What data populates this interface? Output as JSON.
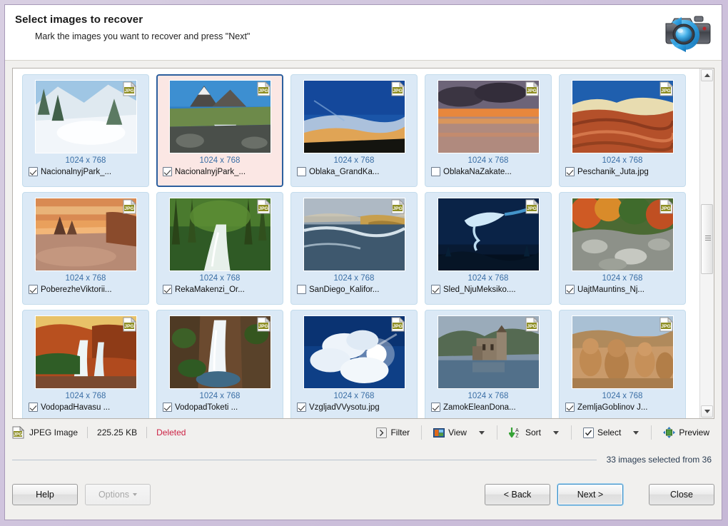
{
  "window": {
    "title": "Select images to recover",
    "subtitle": "Mark the images you want to recover and press \"Next\"",
    "header_icon": "camera-recovery-icon",
    "accent_selected": "#2c5f9e",
    "tile_bg": "#dbe9f6",
    "tile_selected_bg": "#fbe7e4",
    "dims_color": "#3a6ea5",
    "deleted_color": "#cc2244"
  },
  "grid": {
    "items": [
      {
        "name": "NacionalnyjPark_...",
        "dims": "1024 x 768",
        "type": "JPG",
        "checked": true,
        "selected": false,
        "scene": "snow-forest"
      },
      {
        "name": "NacionalnyjPark_...",
        "dims": "1024 x 768",
        "type": "JPG",
        "checked": true,
        "selected": true,
        "scene": "mountain-falls"
      },
      {
        "name": "Oblaka_GrandKa...",
        "dims": "1024 x 768",
        "type": "JPG",
        "checked": false,
        "selected": false,
        "scene": "blue-sky-canyon"
      },
      {
        "name": "OblakaNaZakate...",
        "dims": "1024 x 768",
        "type": "JPG",
        "checked": false,
        "selected": false,
        "scene": "sunset-clouds-water"
      },
      {
        "name": "Peschanik_Juta.jpg",
        "dims": "1024 x 768",
        "type": "JPG",
        "checked": true,
        "selected": false,
        "scene": "red-sandstone"
      },
      {
        "name": "PoberezheViktorii...",
        "dims": "1024 x 768",
        "type": "JPG",
        "checked": true,
        "selected": false,
        "scene": "sunset-sea-stacks"
      },
      {
        "name": "RekaMakenzi_Or...",
        "dims": "1024 x 768",
        "type": "JPG",
        "checked": true,
        "selected": false,
        "scene": "green-forest-stream"
      },
      {
        "name": "SanDiego_Kalifor...",
        "dims": "1024 x 768",
        "type": "JPG",
        "checked": false,
        "selected": false,
        "scene": "coastal-cliffs"
      },
      {
        "name": "Sled_NjuMeksiko....",
        "dims": "1024 x 768",
        "type": "JPG",
        "checked": true,
        "selected": false,
        "scene": "night-contrail"
      },
      {
        "name": "UajtMauntins_Nj...",
        "dims": "1024 x 768",
        "type": "JPG",
        "checked": true,
        "selected": false,
        "scene": "autumn-rocky-river"
      },
      {
        "name": "VodopadHavasu ...",
        "dims": "1024 x 768",
        "type": "JPG",
        "checked": true,
        "selected": false,
        "scene": "havasu-falls"
      },
      {
        "name": "VodopadToketi ...",
        "dims": "1024 x 768",
        "type": "JPG",
        "checked": true,
        "selected": false,
        "scene": "canyon-waterfall"
      },
      {
        "name": "VzgljadVVysotu.jpg",
        "dims": "1024 x 768",
        "type": "JPG",
        "checked": true,
        "selected": false,
        "scene": "sun-through-clouds"
      },
      {
        "name": "ZamokEleanDona...",
        "dims": "1024 x 768",
        "type": "JPG",
        "checked": true,
        "selected": false,
        "scene": "castle-loch"
      },
      {
        "name": "ZemljaGoblinov  J...",
        "dims": "1024 x 768",
        "type": "JPG",
        "checked": true,
        "selected": false,
        "scene": "goblin-valley"
      }
    ]
  },
  "status": {
    "filetype": "JPEG Image",
    "filesize": "225.25 KB",
    "state": "Deleted",
    "filetype_icon": "jpg-file-icon"
  },
  "toolbar": {
    "filter": "Filter",
    "view": "View",
    "sort": "Sort",
    "select": "Select",
    "preview": "Preview"
  },
  "footer": {
    "count": "33 images selected from 36",
    "help": "Help",
    "options": "Options",
    "back": "< Back",
    "next": "Next >",
    "close": "Close"
  }
}
